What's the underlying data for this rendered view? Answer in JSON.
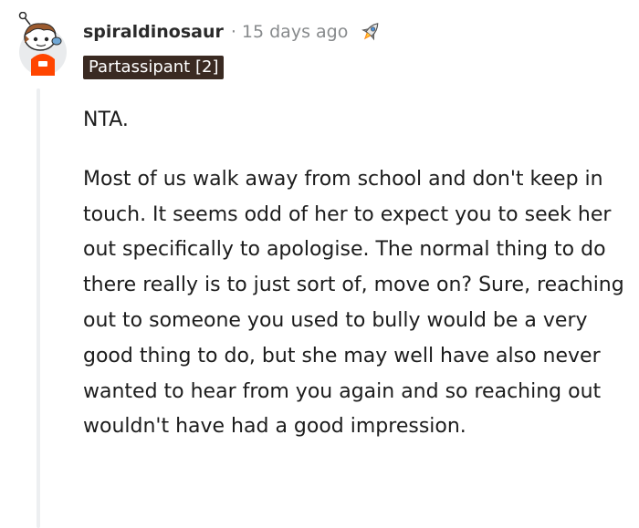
{
  "comment": {
    "username": "spiraldinosaur",
    "separator": "·",
    "timestamp": "15 days ago",
    "award_icon": "rocket-award-icon",
    "flair": "Partassipant [2]",
    "paragraphs": [
      "NTA.",
      "Most of us walk away from school and don't keep in touch. It seems odd of her to expect you to seek her out specifically to apologise. The normal thing to do there really is to just sort of, move on? Sure, reaching out to someone you used to bully would be a very good thing to do, but she may well have also never wanted to hear from you again and so reaching out wouldn't have had a good impression."
    ]
  },
  "colors": {
    "flair_bg": "#3a2a22",
    "flair_text": "#ffffff",
    "timestamp": "#878a8c",
    "thread_line": "#edeff1",
    "avatar_shirt": "#ff4500"
  }
}
